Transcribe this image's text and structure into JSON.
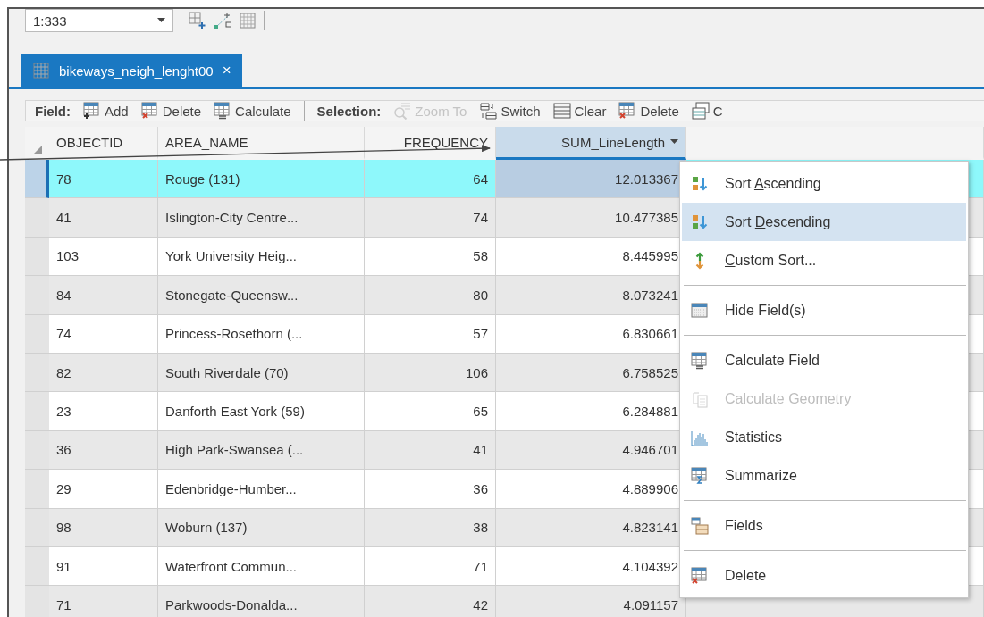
{
  "scale_box": {
    "value": "1:333"
  },
  "table_tab": {
    "title": "bikeways_neigh_lenght00",
    "close": "×",
    "selected": true
  },
  "toolbar": {
    "groups": [
      {
        "label": "Field:",
        "buttons": [
          {
            "label": "Add",
            "disabled": false
          },
          {
            "label": "Delete",
            "disabled": false
          },
          {
            "label": "Calculate",
            "disabled": false
          }
        ]
      },
      {
        "label": "Selection:",
        "buttons": [
          {
            "label": "Zoom To",
            "disabled": true
          },
          {
            "label": "Switch",
            "disabled": false
          },
          {
            "label": "Clear",
            "disabled": false
          },
          {
            "label": "Delete",
            "disabled": false
          },
          {
            "label": "C",
            "disabled": false
          }
        ]
      }
    ]
  },
  "table": {
    "columns": [
      {
        "name": "OBJECTID",
        "selected": false
      },
      {
        "name": "AREA_NAME",
        "selected": false
      },
      {
        "name": "FREQUENCY",
        "selected": false
      },
      {
        "name": "SUM_LineLength",
        "selected": true
      }
    ],
    "rows": [
      {
        "cells": [
          "78",
          "Rouge (131)",
          "64",
          "12.013367"
        ],
        "selected": true
      },
      {
        "cells": [
          "41",
          "Islington-City Centre...",
          "74",
          "10.477385"
        ],
        "selected": false
      },
      {
        "cells": [
          "103",
          "York University Heig...",
          "58",
          "8.445995"
        ],
        "selected": false
      },
      {
        "cells": [
          "84",
          "Stonegate-Queensw...",
          "80",
          "8.073241"
        ],
        "selected": false
      },
      {
        "cells": [
          "74",
          "Princess-Rosethorn (...",
          "57",
          "6.830661"
        ],
        "selected": false
      },
      {
        "cells": [
          "82",
          "South Riverdale (70)",
          "106",
          "6.758525"
        ],
        "selected": false
      },
      {
        "cells": [
          "23",
          "Danforth East York (59)",
          "65",
          "6.284881"
        ],
        "selected": false
      },
      {
        "cells": [
          "36",
          "High Park-Swansea (...",
          "41",
          "4.946701"
        ],
        "selected": false
      },
      {
        "cells": [
          "29",
          "Edenbridge-Humber...",
          "36",
          "4.889906"
        ],
        "selected": false
      },
      {
        "cells": [
          "98",
          "Woburn (137)",
          "38",
          "4.823141"
        ],
        "selected": false
      },
      {
        "cells": [
          "91",
          "Waterfront Commun...",
          "71",
          "4.104392"
        ],
        "selected": false
      },
      {
        "cells": [
          "71",
          "Parkwoods-Donalda...",
          "42",
          "4.091157"
        ],
        "selected": false
      }
    ]
  },
  "context_menu": {
    "items": [
      {
        "kind": "item",
        "before": "Sort ",
        "key": "A",
        "after": "scending",
        "highlighted": false,
        "disabled": false
      },
      {
        "kind": "item",
        "before": "Sort ",
        "key": "D",
        "after": "escending",
        "highlighted": true,
        "disabled": false
      },
      {
        "kind": "item",
        "key": "C",
        "after": "ustom Sort...",
        "highlighted": false,
        "disabled": false
      },
      {
        "kind": "separator"
      },
      {
        "kind": "item",
        "before": "Hide Field(s)",
        "highlighted": false,
        "disabled": false
      },
      {
        "kind": "separator"
      },
      {
        "kind": "item",
        "before": "Calculate Field",
        "highlighted": false,
        "disabled": false
      },
      {
        "kind": "item",
        "before": "Calculate Geometry",
        "highlighted": false,
        "disabled": true
      },
      {
        "kind": "item",
        "before": "Statistics",
        "highlighted": false,
        "disabled": false
      },
      {
        "kind": "item",
        "before": "Summarize",
        "highlighted": false,
        "disabled": false
      },
      {
        "kind": "separator"
      },
      {
        "kind": "item",
        "before": "Fields",
        "highlighted": false,
        "disabled": false
      },
      {
        "kind": "separator"
      },
      {
        "kind": "item",
        "before": "Delete",
        "highlighted": false,
        "disabled": false
      }
    ]
  }
}
